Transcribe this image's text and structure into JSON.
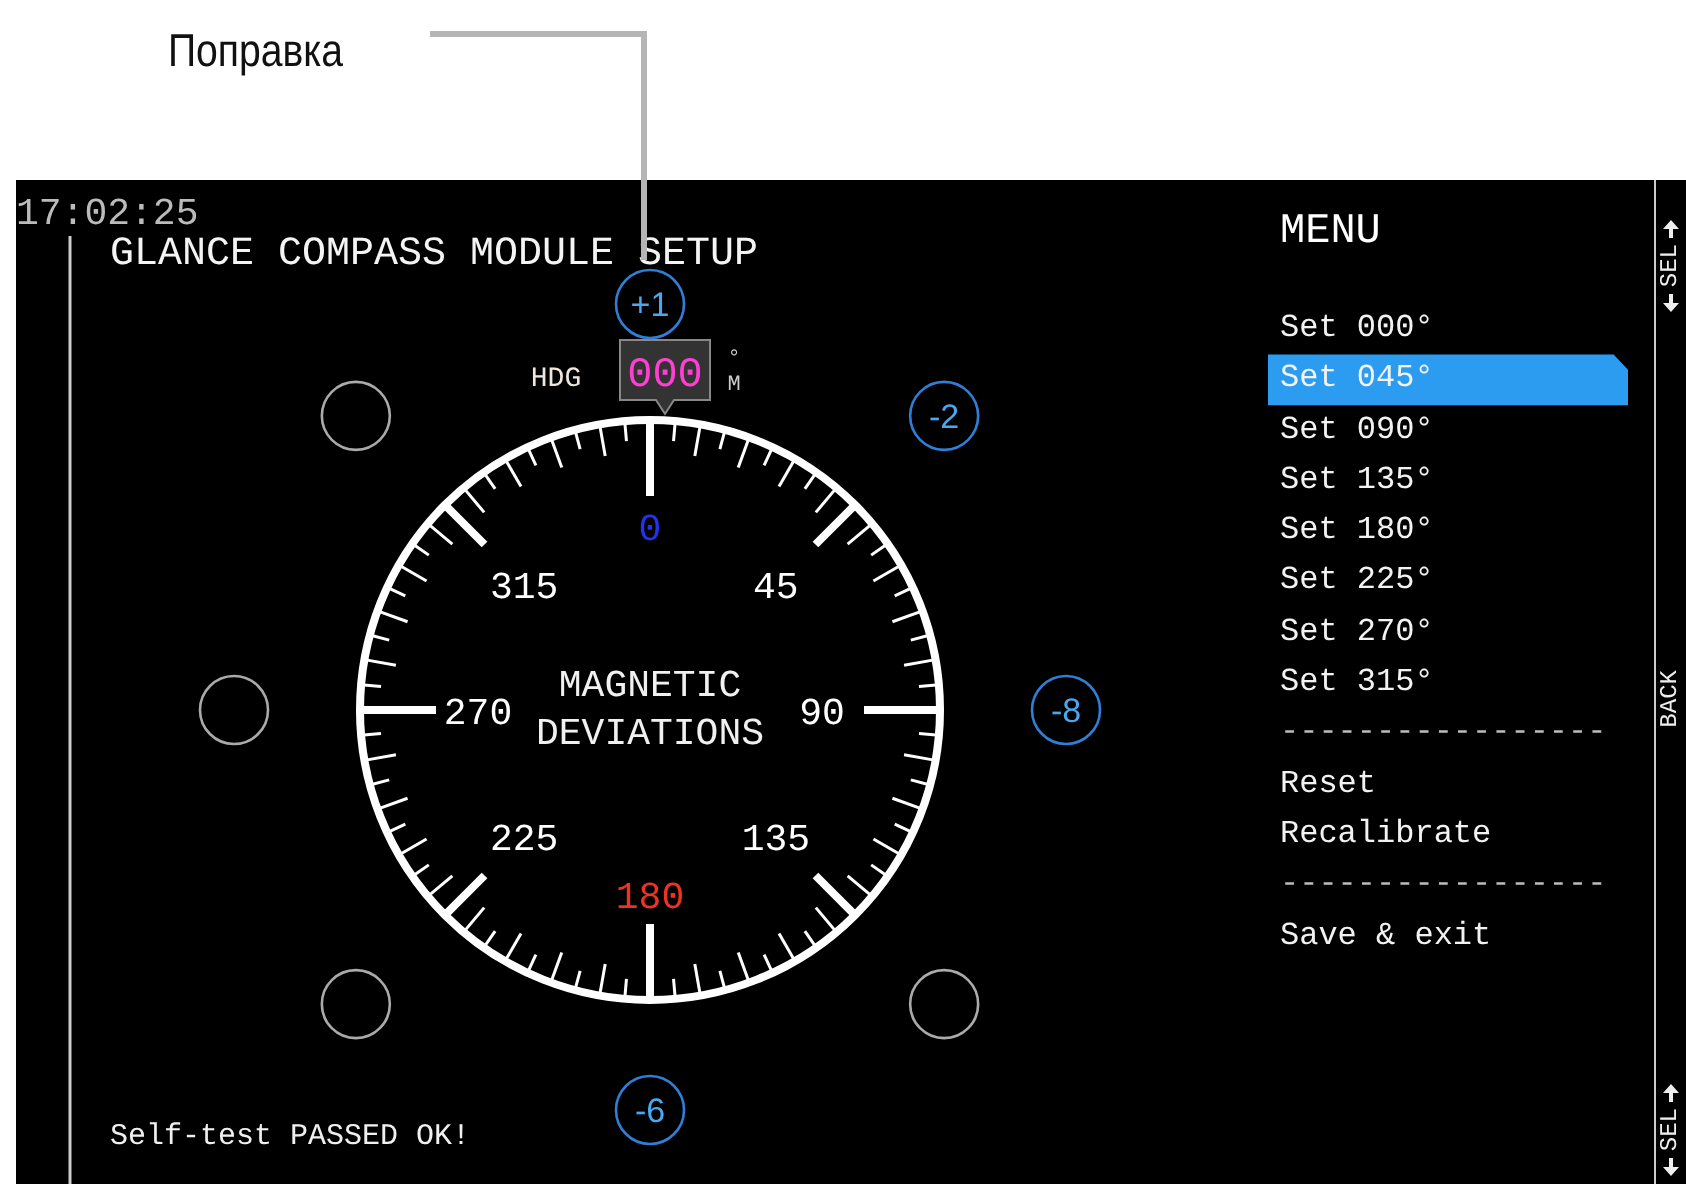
{
  "annotation": {
    "label": "Поправка"
  },
  "screen": {
    "clock": "17:02:25",
    "title": "GLANCE COMPASS MODULE SETUP",
    "heading": {
      "label": "HDG",
      "value": "000",
      "unit_top": "°",
      "unit_bottom": "M"
    },
    "dial": {
      "center_lines": [
        "MAGNETIC",
        "DEVIATIONS"
      ],
      "labels": [
        {
          "text": "0",
          "color": "#2233ee"
        },
        {
          "text": "45",
          "color": "#ffffff"
        },
        {
          "text": "90",
          "color": "#ffffff"
        },
        {
          "text": "135",
          "color": "#ffffff"
        },
        {
          "text": "180",
          "color": "#ee3322"
        },
        {
          "text": "225",
          "color": "#ffffff"
        },
        {
          "text": "270",
          "color": "#ffffff"
        },
        {
          "text": "315",
          "color": "#ffffff"
        }
      ]
    },
    "deviations": [
      {
        "value": "+1",
        "set": true
      },
      {
        "value": "-2",
        "set": true
      },
      {
        "value": "-8",
        "set": true
      },
      {
        "set": false
      },
      {
        "value": "-6",
        "set": true
      },
      {
        "set": false
      },
      {
        "set": false
      },
      {
        "set": false
      }
    ],
    "menu": {
      "title": "MENU",
      "items": [
        {
          "kind": "item",
          "label": "Set 000°",
          "selected": false
        },
        {
          "kind": "item",
          "label": "Set 045°",
          "selected": true
        },
        {
          "kind": "item",
          "label": "Set 090°",
          "selected": false
        },
        {
          "kind": "item",
          "label": "Set 135°",
          "selected": false
        },
        {
          "kind": "item",
          "label": "Set 180°",
          "selected": false
        },
        {
          "kind": "item",
          "label": "Set 225°",
          "selected": false
        },
        {
          "kind": "item",
          "label": "Set 270°",
          "selected": false
        },
        {
          "kind": "item",
          "label": "Set 315°",
          "selected": false
        },
        {
          "kind": "separator",
          "label": "-----------------"
        },
        {
          "kind": "item",
          "label": "Reset",
          "selected": false
        },
        {
          "kind": "item",
          "label": "Recalibrate",
          "selected": false
        },
        {
          "kind": "separator",
          "label": "-----------------"
        },
        {
          "kind": "item",
          "label": "Save & exit",
          "selected": false
        }
      ]
    },
    "status": "Self-test PASSED OK!",
    "softkeys": [
      {
        "label": "SEL",
        "arrows": true
      },
      {
        "label": "BACK",
        "arrows": false
      },
      {
        "label": "SEL",
        "arrows": true
      }
    ]
  }
}
